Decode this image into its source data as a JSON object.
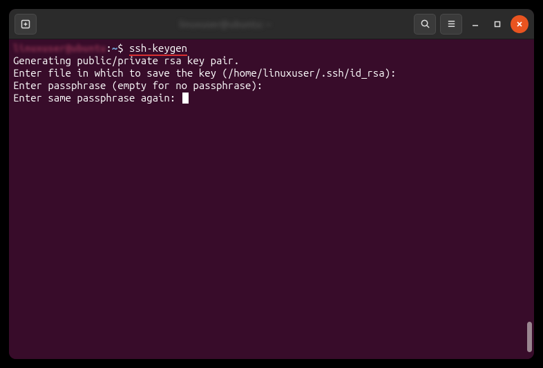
{
  "titlebar": {
    "title": "linuxuser@ubuntu: ~"
  },
  "terminal": {
    "prompt": {
      "user_host": "linuxuser@ubuntu",
      "sep": ":",
      "path": "~",
      "symbol": "$"
    },
    "command": "ssh-keygen",
    "output": {
      "line1": "Generating public/private rsa key pair.",
      "line2": "Enter file in which to save the key (/home/linuxuser/.ssh/id_rsa):",
      "line3": "Enter passphrase (empty for no passphrase):",
      "line4": "Enter same passphrase again: "
    }
  },
  "colors": {
    "bg": "#380c2a",
    "accent": "#e95420",
    "prompt_path": "#729fcf",
    "underline": "#d93030"
  }
}
